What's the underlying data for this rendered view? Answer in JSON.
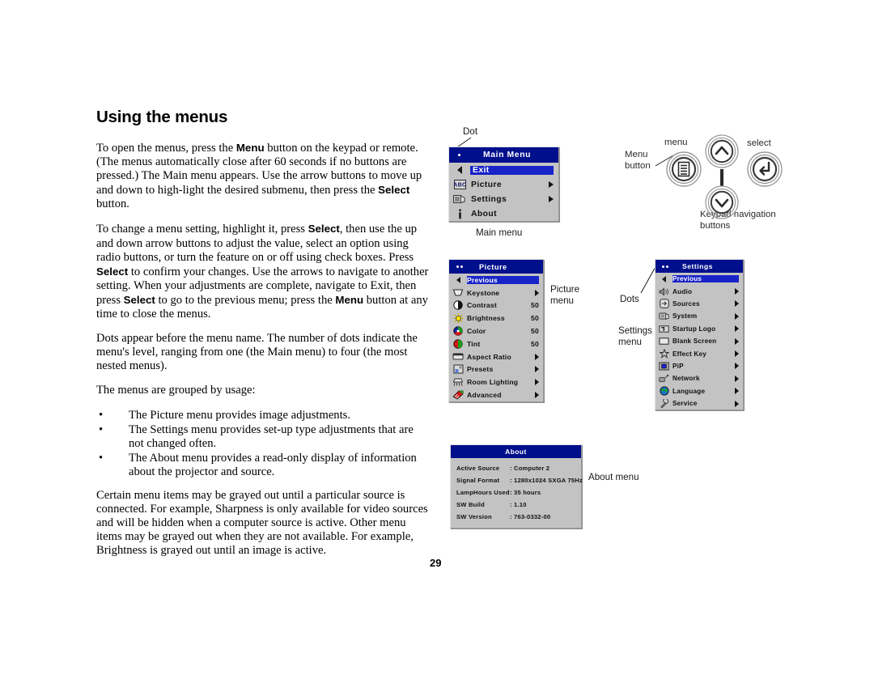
{
  "document": {
    "title": "Using the menus",
    "page_number": "29",
    "paragraphs": [
      "To open the menus, press the {b:Menu} button on the keypad or remote. (The menus automatically close after 60 seconds if no buttons are pressed.) The Main menu appears. Use the arrow buttons to move up and down to high-light the desired submenu, then press the {b:Select} button.",
      "To change a menu setting, highlight it, press {b:Select}, then use the up and down arrow buttons to adjust the value, select an option using radio buttons, or turn the feature on or off using check boxes. Press {b:Select} to confirm your changes. Use the arrows to navigate to another setting. When your adjustments are complete, navigate to Exit, then press {b:Select} to go to the previous menu; press the {b:Menu} button at any time to close the menus.",
      "Dots appear before the menu name. The number of dots indicate the menu's level, ranging from one (the Main menu) to four (the most nested menus).",
      "The menus are grouped by usage:"
    ],
    "bullets": [
      "The Picture menu provides image adjustments.",
      "The Settings menu provides set-up type adjustments that are not changed often.",
      "The About menu provides a read-only display of information about the projector and source."
    ],
    "closing_paragraph": "Certain menu items may be grayed out until a particular source is connected. For example, Sharpness is only available for video sources and will be hidden when a computer source is active. Other menu items may be grayed out when they are not available. For example, Brightness is grayed out until an image is active.",
    "bullet_glyph": "•"
  },
  "callouts": {
    "dot": "Dot",
    "main_menu": "Main menu",
    "picture_menu": "Picture\nmenu",
    "dots": "Dots",
    "settings_menu": "Settings\nmenu",
    "about_menu": "About menu"
  },
  "keypad": {
    "menu_button_label": "Menu\nbutton",
    "menu_label": "menu",
    "select_label": "select",
    "caption": "Keypad navigation\nbuttons",
    "icons": {
      "menu": "menu-list-icon",
      "select": "enter-arrow-icon",
      "up": "chevron-up-icon",
      "down": "chevron-down-icon"
    }
  },
  "colors": {
    "osd_titlebar": "#000f8c",
    "osd_body": "#c3c3c3",
    "osd_highlight": "#1823c8",
    "osd_title_text": "#ffffff",
    "osd_text": "#101010"
  },
  "main_menu": {
    "title": "Main Menu",
    "dot_count": 1,
    "items": [
      {
        "label": "Exit",
        "icon": "left-caret-icon",
        "selected": true,
        "arrow": false
      },
      {
        "label": "Picture",
        "icon": "abc-picture-icon",
        "selected": false,
        "arrow": true
      },
      {
        "label": "Settings",
        "icon": "sliders-settings-icon",
        "selected": false,
        "arrow": true
      },
      {
        "label": "About",
        "icon": "info-i-icon",
        "selected": false,
        "arrow": false
      }
    ]
  },
  "picture_menu": {
    "title": "Picture",
    "dot_count": 2,
    "items": [
      {
        "label": "Previous",
        "icon": "left-caret-icon",
        "selected": true,
        "arrow": false,
        "value": ""
      },
      {
        "label": "Keystone",
        "icon": "keystone-icon",
        "selected": false,
        "arrow": true,
        "value": ""
      },
      {
        "label": "Contrast",
        "icon": "contrast-icon",
        "selected": false,
        "arrow": false,
        "value": "50"
      },
      {
        "label": "Brightness",
        "icon": "brightness-sun-icon",
        "selected": false,
        "arrow": false,
        "value": "50"
      },
      {
        "label": "Color",
        "icon": "color-wheel-icon",
        "selected": false,
        "arrow": false,
        "value": "50"
      },
      {
        "label": "Tint",
        "icon": "tint-icon",
        "selected": false,
        "arrow": false,
        "value": "50"
      },
      {
        "label": "Aspect Ratio",
        "icon": "aspect-ratio-icon",
        "selected": false,
        "arrow": true,
        "value": ""
      },
      {
        "label": "Presets",
        "icon": "presets-icon",
        "selected": false,
        "arrow": true,
        "value": ""
      },
      {
        "label": "Room Lighting",
        "icon": "room-lighting-icon",
        "selected": false,
        "arrow": true,
        "value": ""
      },
      {
        "label": "Advanced",
        "icon": "advanced-icon",
        "selected": false,
        "arrow": true,
        "value": ""
      }
    ]
  },
  "settings_menu": {
    "title": "Settings",
    "dot_count": 2,
    "items": [
      {
        "label": "Previous",
        "icon": "left-caret-icon",
        "selected": true,
        "arrow": false
      },
      {
        "label": "Audio",
        "icon": "speaker-audio-icon",
        "selected": false,
        "arrow": true
      },
      {
        "label": "Sources",
        "icon": "sources-input-icon",
        "selected": false,
        "arrow": true
      },
      {
        "label": "System",
        "icon": "system-icon",
        "selected": false,
        "arrow": true
      },
      {
        "label": "Startup Logo",
        "icon": "startup-logo-icon",
        "selected": false,
        "arrow": true
      },
      {
        "label": "Blank Screen",
        "icon": "blank-screen-icon",
        "selected": false,
        "arrow": true
      },
      {
        "label": "Effect Key",
        "icon": "star-effect-icon",
        "selected": false,
        "arrow": true
      },
      {
        "label": "PiP",
        "icon": "pip-icon",
        "selected": false,
        "arrow": true
      },
      {
        "label": "Network",
        "icon": "network-icon",
        "selected": false,
        "arrow": true
      },
      {
        "label": "Language",
        "icon": "globe-language-icon",
        "selected": false,
        "arrow": true
      },
      {
        "label": "Service",
        "icon": "wrench-service-icon",
        "selected": false,
        "arrow": true
      }
    ]
  },
  "about_menu": {
    "title": "About",
    "rows": [
      {
        "key": "Active Source",
        "value": ": Computer 2"
      },
      {
        "key": "Signal Format",
        "value": ": 1280x1024 SXGA    75Hz"
      },
      {
        "key": "LampHours Used",
        "value": ": 35 hours"
      },
      {
        "key": "SW Build",
        "value": ": 1.10"
      },
      {
        "key": "SW Version",
        "value": ": 763-0332-00"
      }
    ]
  }
}
